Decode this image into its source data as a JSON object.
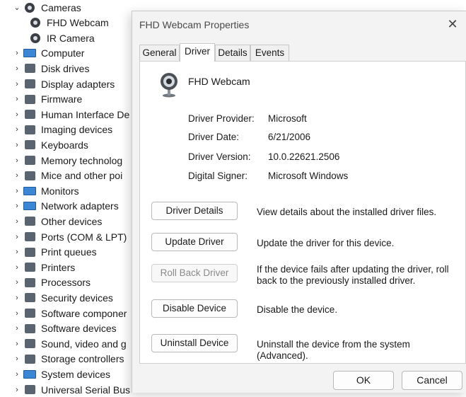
{
  "tree": {
    "items": [
      {
        "label": "Cameras",
        "chevron": "⌄",
        "icon": "camera-icon",
        "level": 0
      },
      {
        "label": "FHD Webcam",
        "chevron": "",
        "icon": "camera-icon",
        "level": 1
      },
      {
        "label": "IR Camera",
        "chevron": "",
        "icon": "camera-icon",
        "level": 1
      },
      {
        "label": "Computer",
        "chevron": "›",
        "icon": "computer-icon",
        "level": 0
      },
      {
        "label": "Disk drives",
        "chevron": "›",
        "icon": "disk-drive-icon",
        "level": 0
      },
      {
        "label": "Display adapters",
        "chevron": "›",
        "icon": "display-adapter-icon",
        "level": 0
      },
      {
        "label": "Firmware",
        "chevron": "›",
        "icon": "firmware-icon",
        "level": 0
      },
      {
        "label": "Human Interface De",
        "chevron": "›",
        "icon": "hid-icon",
        "level": 0
      },
      {
        "label": "Imaging devices",
        "chevron": "›",
        "icon": "imaging-icon",
        "level": 0
      },
      {
        "label": "Keyboards",
        "chevron": "›",
        "icon": "keyboard-icon",
        "level": 0
      },
      {
        "label": "Memory technolog",
        "chevron": "›",
        "icon": "memory-icon",
        "level": 0
      },
      {
        "label": "Mice and other poi",
        "chevron": "›",
        "icon": "mouse-icon",
        "level": 0
      },
      {
        "label": "Monitors",
        "chevron": "›",
        "icon": "monitor-icon",
        "level": 0
      },
      {
        "label": "Network adapters",
        "chevron": "›",
        "icon": "network-icon",
        "level": 0
      },
      {
        "label": "Other devices",
        "chevron": "›",
        "icon": "other-devices-icon",
        "level": 0
      },
      {
        "label": "Ports (COM & LPT)",
        "chevron": "›",
        "icon": "ports-icon",
        "level": 0
      },
      {
        "label": "Print queues",
        "chevron": "›",
        "icon": "print-queue-icon",
        "level": 0
      },
      {
        "label": "Printers",
        "chevron": "›",
        "icon": "printer-icon",
        "level": 0
      },
      {
        "label": "Processors",
        "chevron": "›",
        "icon": "processor-icon",
        "level": 0
      },
      {
        "label": "Security devices",
        "chevron": "›",
        "icon": "security-icon",
        "level": 0
      },
      {
        "label": "Software componer",
        "chevron": "›",
        "icon": "software-component-icon",
        "level": 0
      },
      {
        "label": "Software devices",
        "chevron": "›",
        "icon": "software-device-icon",
        "level": 0
      },
      {
        "label": "Sound, video and g",
        "chevron": "›",
        "icon": "sound-icon",
        "level": 0
      },
      {
        "label": "Storage controllers",
        "chevron": "›",
        "icon": "storage-icon",
        "level": 0
      },
      {
        "label": "System devices",
        "chevron": "›",
        "icon": "system-devices-icon",
        "level": 0
      },
      {
        "label": "Universal Serial Bus",
        "chevron": "›",
        "icon": "usb-icon",
        "level": 0
      }
    ]
  },
  "dialog": {
    "title": "FHD Webcam Properties",
    "close": "✕",
    "tabs": [
      {
        "label": "General",
        "active": false
      },
      {
        "label": "Driver",
        "active": true
      },
      {
        "label": "Details",
        "active": false
      },
      {
        "label": "Events",
        "active": false
      }
    ],
    "device_name": "FHD Webcam",
    "info": [
      {
        "key": "Driver Provider:",
        "value": "Microsoft"
      },
      {
        "key": "Driver Date:",
        "value": "6/21/2006"
      },
      {
        "key": "Driver Version:",
        "value": "10.0.22621.2506"
      },
      {
        "key": "Digital Signer:",
        "value": "Microsoft Windows"
      }
    ],
    "actions": [
      {
        "button": "Driver Details",
        "description": "View details about the installed driver files.",
        "enabled": true
      },
      {
        "button": "Update Driver",
        "description": "Update the driver for this device.",
        "enabled": true
      },
      {
        "button": "Roll Back Driver",
        "description": "If the device fails after updating the driver, roll back to the previously installed driver.",
        "enabled": false
      },
      {
        "button": "Disable Device",
        "description": "Disable the device.",
        "enabled": true
      },
      {
        "button": "Uninstall Device",
        "description": "Uninstall the device from the system (Advanced).",
        "enabled": true
      }
    ],
    "ok_label": "OK",
    "cancel_label": "Cancel"
  }
}
